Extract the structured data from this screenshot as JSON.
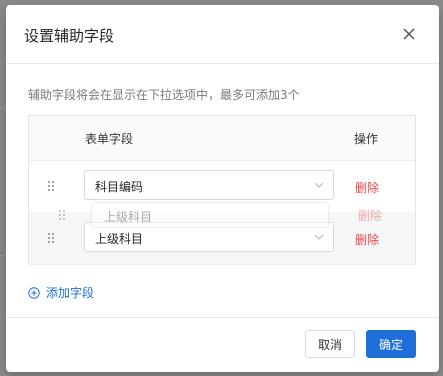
{
  "dialog": {
    "title": "设置辅助字段",
    "description": "辅助字段将会在显示在下拉选项中，最多可添加3个"
  },
  "table": {
    "col_field": "表单字段",
    "col_action": "操作",
    "rows": [
      {
        "value": "科目编码",
        "delete_label": "删除"
      },
      {
        "value": "上级科目",
        "delete_label": "删除"
      }
    ],
    "drag_ghost": {
      "value": "上级科目",
      "delete_label": "删除"
    }
  },
  "add_field_label": "添加字段",
  "footer": {
    "cancel_label": "取消",
    "ok_label": "确定"
  },
  "colors": {
    "primary": "#1f6fdb",
    "danger": "#e5484d"
  }
}
